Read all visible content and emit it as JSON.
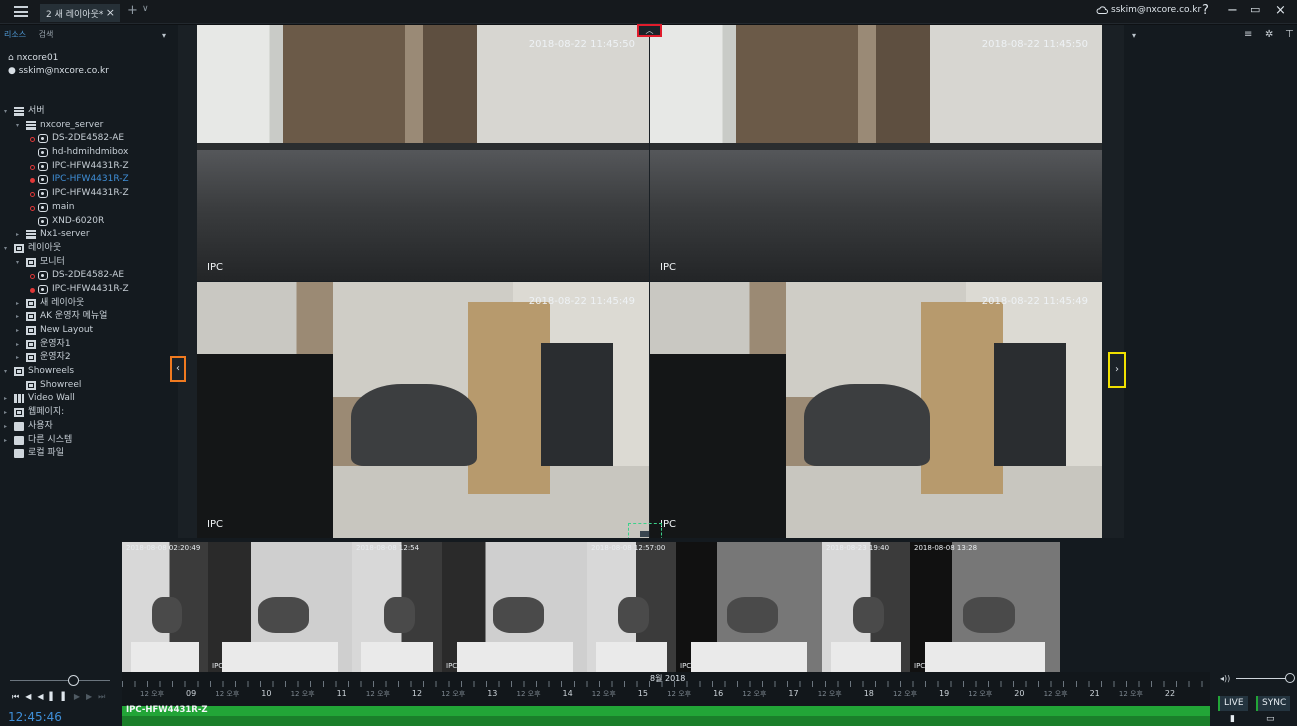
{
  "titlebar": {
    "tab_label": "2 새 레이아웃*",
    "tab_close": "×",
    "new_tab": "+",
    "tab_menu": "∨",
    "user": "sskim@nxcore.co.kr",
    "help": "?",
    "minimize": "−",
    "restore": "▭",
    "close": "×"
  },
  "left_panel": {
    "tabs": [
      "리소스",
      "검색"
    ],
    "pin_icon": "pin-icon",
    "system_name": "nxcore01",
    "account": "sskim@nxcore.co.kr",
    "tree": [
      {
        "label": "서버",
        "level": 0,
        "arrow": "▾",
        "icon": "servers"
      },
      {
        "label": "nxcore_server",
        "level": 1,
        "arrow": "▾",
        "icon": "server"
      },
      {
        "label": "DS-2DE4582-AE",
        "level": 2,
        "dot": "ring",
        "icon": "camera"
      },
      {
        "label": "hd-hdmihdmibox",
        "level": 2,
        "icon": "camera"
      },
      {
        "label": "IPC-HFW4431R-Z",
        "level": 2,
        "dot": "ring",
        "icon": "camera"
      },
      {
        "label": "IPC-HFW4431R-Z",
        "level": 2,
        "dot": "full",
        "icon": "camera",
        "selected": true
      },
      {
        "label": "IPC-HFW4431R-Z",
        "level": 2,
        "dot": "ring",
        "icon": "camera"
      },
      {
        "label": "main",
        "level": 2,
        "dot": "ring",
        "icon": "camera"
      },
      {
        "label": "XND-6020R",
        "level": 2,
        "icon": "camera"
      },
      {
        "label": "Nx1-server",
        "level": 1,
        "arrow": "▸",
        "icon": "server"
      },
      {
        "label": "레이아웃",
        "level": 0,
        "arrow": "▾",
        "icon": "layouts"
      },
      {
        "label": "모니터",
        "level": 1,
        "arrow": "▾",
        "icon": "layout"
      },
      {
        "label": "DS-2DE4582-AE",
        "level": 2,
        "dot": "ring",
        "icon": "camera"
      },
      {
        "label": "IPC-HFW4431R-Z",
        "level": 2,
        "dot": "full",
        "icon": "camera"
      },
      {
        "label": "새 레이아웃",
        "level": 1,
        "arrow": "▸",
        "icon": "layout"
      },
      {
        "label": "AK 운영자 메뉴얼",
        "level": 1,
        "arrow": "▸",
        "icon": "layout"
      },
      {
        "label": "New Layout",
        "level": 1,
        "arrow": "▸",
        "icon": "layout"
      },
      {
        "label": "운영자1",
        "level": 1,
        "arrow": "▸",
        "icon": "layout"
      },
      {
        "label": "운영자2",
        "level": 1,
        "arrow": "▸",
        "icon": "layout"
      },
      {
        "label": "Showreels",
        "level": 0,
        "arrow": "▾",
        "icon": "showreels"
      },
      {
        "label": "Showreel",
        "level": 1,
        "icon": "layout"
      },
      {
        "label": "Video Wall",
        "level": 0,
        "arrow": "▸",
        "icon": "videowall"
      },
      {
        "label": "웹페이지:",
        "level": 0,
        "arrow": "▸",
        "icon": "web"
      },
      {
        "label": "사용자",
        "level": 0,
        "arrow": "▸",
        "icon": "users"
      },
      {
        "label": "다른 시스템",
        "level": 0,
        "arrow": "▸",
        "icon": "systems"
      },
      {
        "label": "로컬 파일",
        "level": 0,
        "icon": "folder"
      }
    ]
  },
  "scene": {
    "tiles": [
      {
        "timestamp": "2018-08-22 11:45:50",
        "caption": "IPC"
      },
      {
        "timestamp": "2018-08-22 11:45:50",
        "caption": "IPC"
      },
      {
        "timestamp": "2018-08-22 11:45:49",
        "caption": "IPC"
      },
      {
        "timestamp": "2018-08-22 11:45:49",
        "caption": "IPC"
      }
    ]
  },
  "handles": {
    "left": "‹",
    "right": "›",
    "top": "︿"
  },
  "right_panel": {
    "pin_icon": "pin-icon",
    "icons": [
      "list-icon",
      "gear-icon",
      "filter-icon"
    ]
  },
  "thumbnails": [
    {
      "timestamp": "2018-08-08 02:20:49",
      "caption": ""
    },
    {
      "timestamp": "",
      "caption": "IPC"
    },
    {
      "timestamp": "2018-08-08 12:54",
      "caption": ""
    },
    {
      "timestamp": "",
      "caption": "IPC"
    },
    {
      "timestamp": "2018-08-08 12:57:00",
      "caption": ""
    },
    {
      "timestamp": "",
      "caption": "IPC"
    },
    {
      "timestamp": "2018-08-23 19:40",
      "caption": ""
    },
    {
      "timestamp": "2018-08-08 13:28",
      "caption": "IPC"
    }
  ],
  "timeline": {
    "month_label": "8월 2018",
    "hour_labels": [
      {
        "ampm": "12 오후",
        "hour": "09"
      },
      {
        "ampm": "12 오후",
        "hour": "10"
      },
      {
        "ampm": "12 오후",
        "hour": "11"
      },
      {
        "ampm": "12 오후",
        "hour": "12"
      },
      {
        "ampm": "12 오후",
        "hour": "13"
      },
      {
        "ampm": "12 오후",
        "hour": "14"
      },
      {
        "ampm": "12 오후",
        "hour": "15"
      },
      {
        "ampm": "12 오후",
        "hour": "16"
      },
      {
        "ampm": "12 오후",
        "hour": "17"
      },
      {
        "ampm": "12 오후",
        "hour": "18"
      },
      {
        "ampm": "12 오후",
        "hour": "19"
      },
      {
        "ampm": "12 오후",
        "hour": "20"
      },
      {
        "ampm": "12 오후",
        "hour": "21"
      },
      {
        "ampm": "12 오후",
        "hour": "22"
      }
    ],
    "camera_name": "IPC-HFW4431R-Z",
    "current_time": "12:45:46",
    "live_label": "LIVE",
    "sync_label": "SYNC",
    "volume_icon": "◂))",
    "bookmark_icon": "bookmark-icon",
    "calendar_icon": "calendar-icon",
    "chunk_color": "#22a537"
  },
  "playback": {
    "prev": "⏮",
    "rewind": "◀◀",
    "pause": "▌▌",
    "forward": "▶▶",
    "next": "⏭"
  },
  "colors": {
    "accent_blue": "#3f8fd8",
    "record_red": "#e03838",
    "handle_left": "#f07a20",
    "handle_right": "#f0e000",
    "handle_top": "#e01c2c",
    "handle_bottom": "#3bd18a"
  }
}
